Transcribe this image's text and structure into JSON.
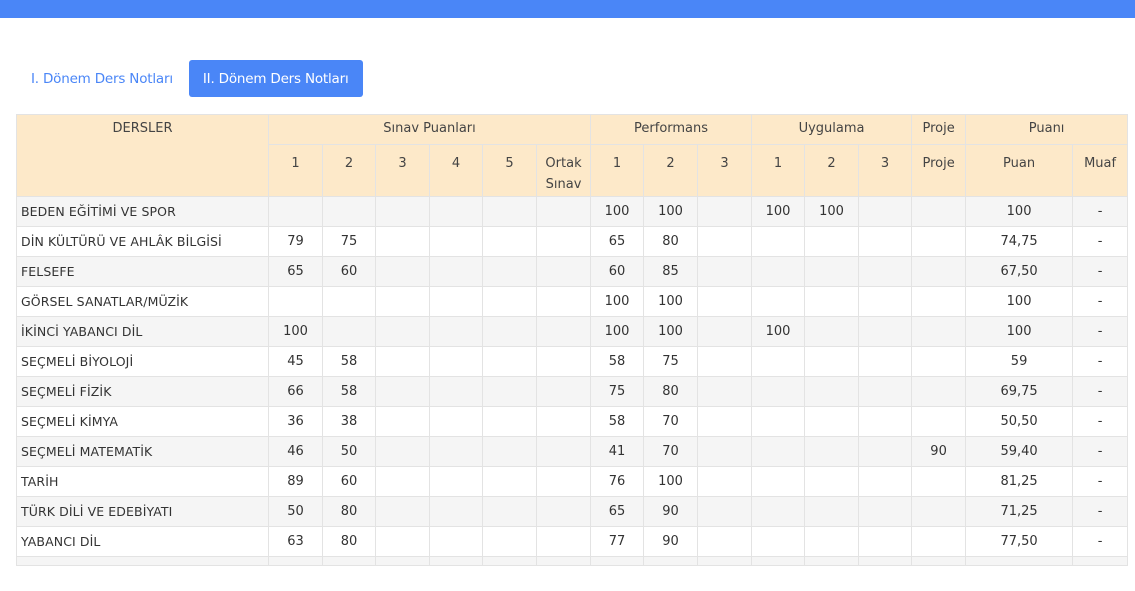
{
  "tabs": [
    {
      "label": "I. Dönem Ders Notları"
    },
    {
      "label": "II. Dönem Ders Notları"
    }
  ],
  "table": {
    "headers": {
      "dersler": "DERSLER",
      "sinav": "Sınav Puanları",
      "performans": "Performans",
      "uygulama": "Uygulama",
      "proje": "Proje",
      "puani": "Puanı",
      "sinav_cols": [
        "1",
        "2",
        "3",
        "4",
        "5",
        "Ortak Sınav"
      ],
      "performans_cols": [
        "1",
        "2",
        "3"
      ],
      "uygulama_cols": [
        "1",
        "2",
        "3"
      ],
      "proje_col": "Proje",
      "puan_col": "Puan",
      "muaf_col": "Muaf"
    },
    "rows": [
      {
        "cells": [
          "BEDEN EĞİTİMİ VE SPOR",
          "",
          "",
          "",
          "",
          "",
          "",
          "100",
          "100",
          "",
          "100",
          "100",
          "",
          "",
          "100",
          "-"
        ]
      },
      {
        "cells": [
          "DİN KÜLTÜRÜ VE AHLÂK BİLGİSİ",
          "79",
          "75",
          "",
          "",
          "",
          "",
          "65",
          "80",
          "",
          "",
          "",
          "",
          "",
          "74,75",
          "-"
        ]
      },
      {
        "cells": [
          "FELSEFE",
          "65",
          "60",
          "",
          "",
          "",
          "",
          "60",
          "85",
          "",
          "",
          "",
          "",
          "",
          "67,50",
          "-"
        ]
      },
      {
        "cells": [
          "GÖRSEL SANATLAR/MÜZİK",
          "",
          "",
          "",
          "",
          "",
          "",
          "100",
          "100",
          "",
          "",
          "",
          "",
          "",
          "100",
          "-"
        ]
      },
      {
        "cells": [
          "İKİNCİ YABANCI DİL",
          "100",
          "",
          "",
          "",
          "",
          "",
          "100",
          "100",
          "",
          "100",
          "",
          "",
          "",
          "100",
          "-"
        ]
      },
      {
        "cells": [
          "SEÇMELİ BİYOLOJİ",
          "45",
          "58",
          "",
          "",
          "",
          "",
          "58",
          "75",
          "",
          "",
          "",
          "",
          "",
          "59",
          "-"
        ]
      },
      {
        "cells": [
          "SEÇMELİ FİZİK",
          "66",
          "58",
          "",
          "",
          "",
          "",
          "75",
          "80",
          "",
          "",
          "",
          "",
          "",
          "69,75",
          "-"
        ]
      },
      {
        "cells": [
          "SEÇMELİ KİMYA",
          "36",
          "38",
          "",
          "",
          "",
          "",
          "58",
          "70",
          "",
          "",
          "",
          "",
          "",
          "50,50",
          "-"
        ]
      },
      {
        "cells": [
          "SEÇMELİ MATEMATİK",
          "46",
          "50",
          "",
          "",
          "",
          "",
          "41",
          "70",
          "",
          "",
          "",
          "",
          "90",
          "59,40",
          "-"
        ]
      },
      {
        "cells": [
          "TARİH",
          "89",
          "60",
          "",
          "",
          "",
          "",
          "76",
          "100",
          "",
          "",
          "",
          "",
          "",
          "81,25",
          "-"
        ]
      },
      {
        "cells": [
          "TÜRK DİLİ VE EDEBİYATI",
          "50",
          "80",
          "",
          "",
          "",
          "",
          "65",
          "90",
          "",
          "",
          "",
          "",
          "",
          "71,25",
          "-"
        ]
      },
      {
        "cells": [
          "YABANCI DİL",
          "63",
          "80",
          "",
          "",
          "",
          "",
          "77",
          "90",
          "",
          "",
          "",
          "",
          "",
          "77,50",
          "-"
        ]
      }
    ]
  },
  "colors": {
    "accent": "#4a86f7",
    "header_bg": "#fde9c9",
    "row_alt": "#f5f5f5"
  }
}
